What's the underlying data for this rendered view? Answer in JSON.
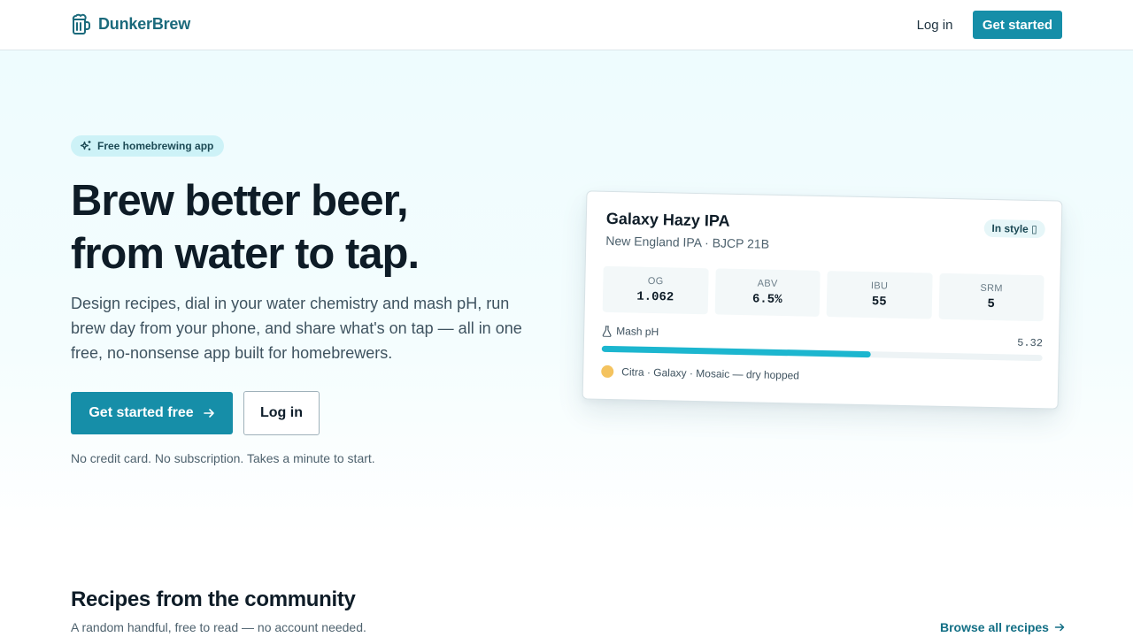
{
  "header": {
    "brand": "DunkerBrew",
    "login_label": "Log in",
    "cta_label": "Get started"
  },
  "hero": {
    "badge": "Free homebrewing app",
    "title_line1": "Brew better beer,",
    "title_line2": "from water to tap.",
    "subtitle": "Design recipes, dial in your water chemistry and mash pH, run brew day from your phone, and share what's on tap — all in one free, no-nonsense app built for homebrewers.",
    "primary_cta": "Get started free",
    "secondary_cta": "Log in",
    "note": "No credit card. No subscription. Takes a minute to start."
  },
  "recipe_card": {
    "name": "Galaxy Hazy IPA",
    "style": "New England IPA · BJCP 21B",
    "status": "In style ▯",
    "stats": [
      {
        "label": "OG",
        "value": "1.062"
      },
      {
        "label": "ABV",
        "value": "6.5%"
      },
      {
        "label": "IBU",
        "value": "55"
      },
      {
        "label": "SRM",
        "value": "5"
      }
    ],
    "mash_ph_label": "Mash pH",
    "mash_ph_value": "5.32",
    "mash_ph_fill_fraction": 0.61,
    "hops": "Citra · Galaxy · Mosaic — dry hopped",
    "hop_color": "#f4c35f"
  },
  "community": {
    "title": "Recipes from the community",
    "subtitle": "A random handful, free to read — no account needed.",
    "browse_label": "Browse all recipes"
  },
  "colors": {
    "accent": "#168ea8",
    "brand": "#1b6a7c",
    "ph_bar": "#1cb6cf"
  }
}
